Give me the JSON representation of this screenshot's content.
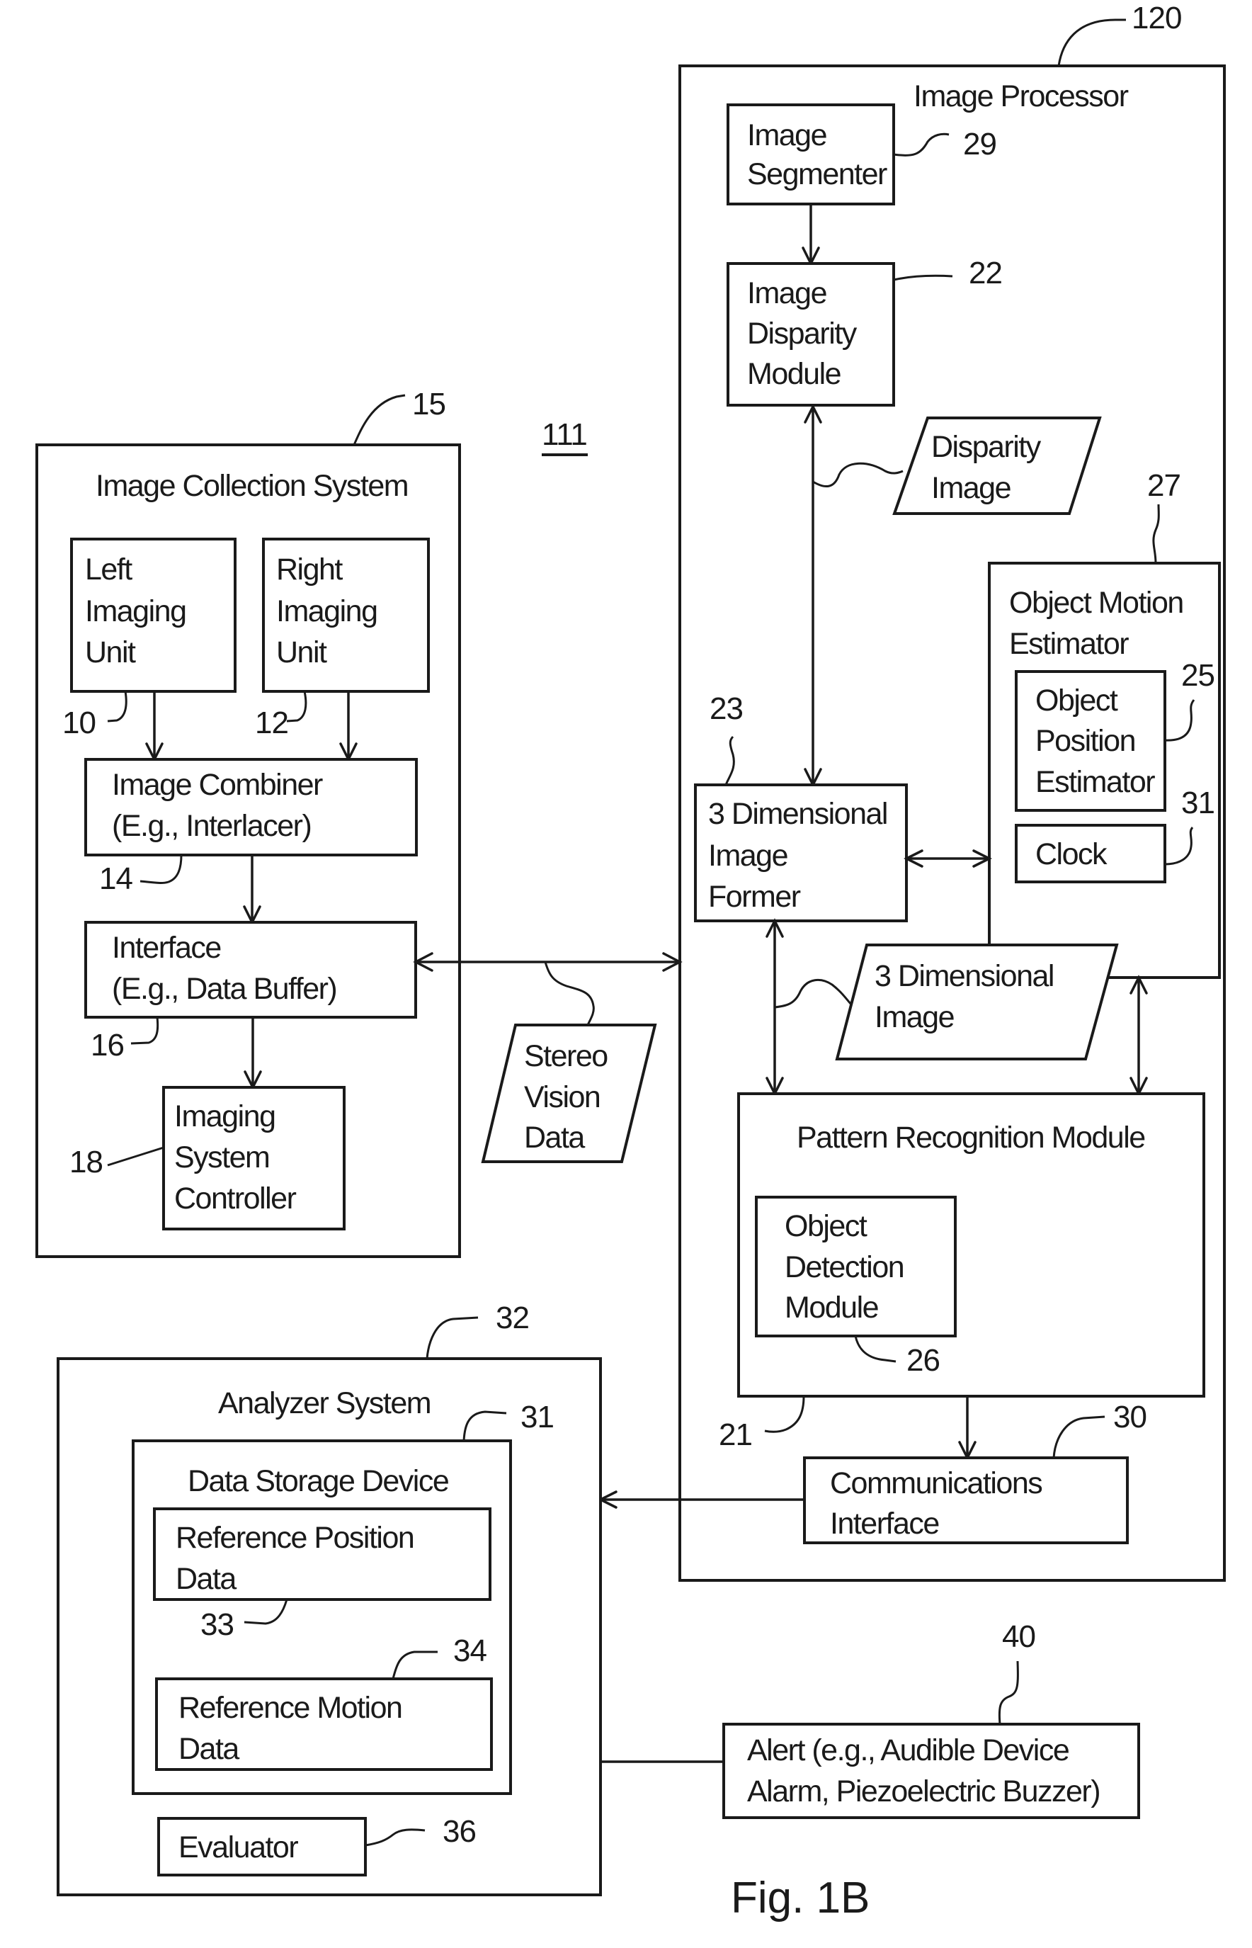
{
  "figure": {
    "caption": "Fig. 1B",
    "system_ref": "111"
  },
  "image_collection_system": {
    "title": "Image Collection System",
    "ref": "15",
    "left_imaging_unit": {
      "lines": [
        "Left",
        "Imaging",
        "Unit"
      ],
      "ref": "10"
    },
    "right_imaging_unit": {
      "lines": [
        "Right",
        "Imaging",
        "Unit"
      ],
      "ref": "12"
    },
    "image_combiner": {
      "lines": [
        "Image Combiner",
        "(E.g., Interlacer)"
      ],
      "ref": "14"
    },
    "interface": {
      "lines": [
        "Interface",
        "(E.g., Data Buffer)"
      ],
      "ref": "16"
    },
    "imaging_system_controller": {
      "lines": [
        "Imaging",
        "System",
        "Controller"
      ],
      "ref": "18"
    }
  },
  "stereo_vision_data": {
    "lines": [
      "Stereo",
      "Vision",
      "Data"
    ]
  },
  "image_processor": {
    "title": "Image Processor",
    "ref": "120",
    "image_segmenter": {
      "lines": [
        "Image",
        "Segmenter"
      ],
      "ref": "29"
    },
    "image_disparity_module": {
      "lines": [
        "Image",
        "Disparity",
        "Module"
      ],
      "ref": "22"
    },
    "disparity_image": {
      "lines": [
        "Disparity",
        "Image"
      ]
    },
    "three_d_image_former": {
      "lines": [
        "3 Dimensional",
        "Image",
        "Former"
      ],
      "ref": "23"
    },
    "object_motion_estimator": {
      "lines": [
        "Object Motion",
        "Estimator"
      ],
      "ref": "27",
      "object_position_estimator": {
        "lines": [
          "Object",
          "Position",
          "Estimator"
        ],
        "ref": "25"
      },
      "clock": {
        "lines": [
          "Clock"
        ],
        "ref": "31"
      }
    },
    "three_d_image": {
      "lines": [
        "3 Dimensional",
        "Image"
      ]
    },
    "pattern_recognition_module": {
      "title": "Pattern Recognition Module",
      "ref": "21",
      "object_detection_module": {
        "lines": [
          "Object",
          "Detection",
          "Module"
        ],
        "ref": "26"
      }
    },
    "communications_interface": {
      "lines": [
        "Communications",
        "Interface"
      ],
      "ref": "30"
    }
  },
  "analyzer_system": {
    "title": "Analyzer System",
    "ref": "32",
    "data_storage_device": {
      "title": "Data Storage Device",
      "ref": "31",
      "reference_position_data": {
        "lines": [
          "Reference Position",
          "Data"
        ],
        "ref": "33"
      },
      "reference_motion_data": {
        "lines": [
          "Reference Motion",
          "Data"
        ],
        "ref": "34"
      }
    },
    "evaluator": {
      "lines": [
        "Evaluator"
      ],
      "ref": "36"
    }
  },
  "alert": {
    "lines": [
      "Alert (e.g., Audible Device",
      "Alarm, Piezoelectric Buzzer)"
    ],
    "ref": "40"
  }
}
